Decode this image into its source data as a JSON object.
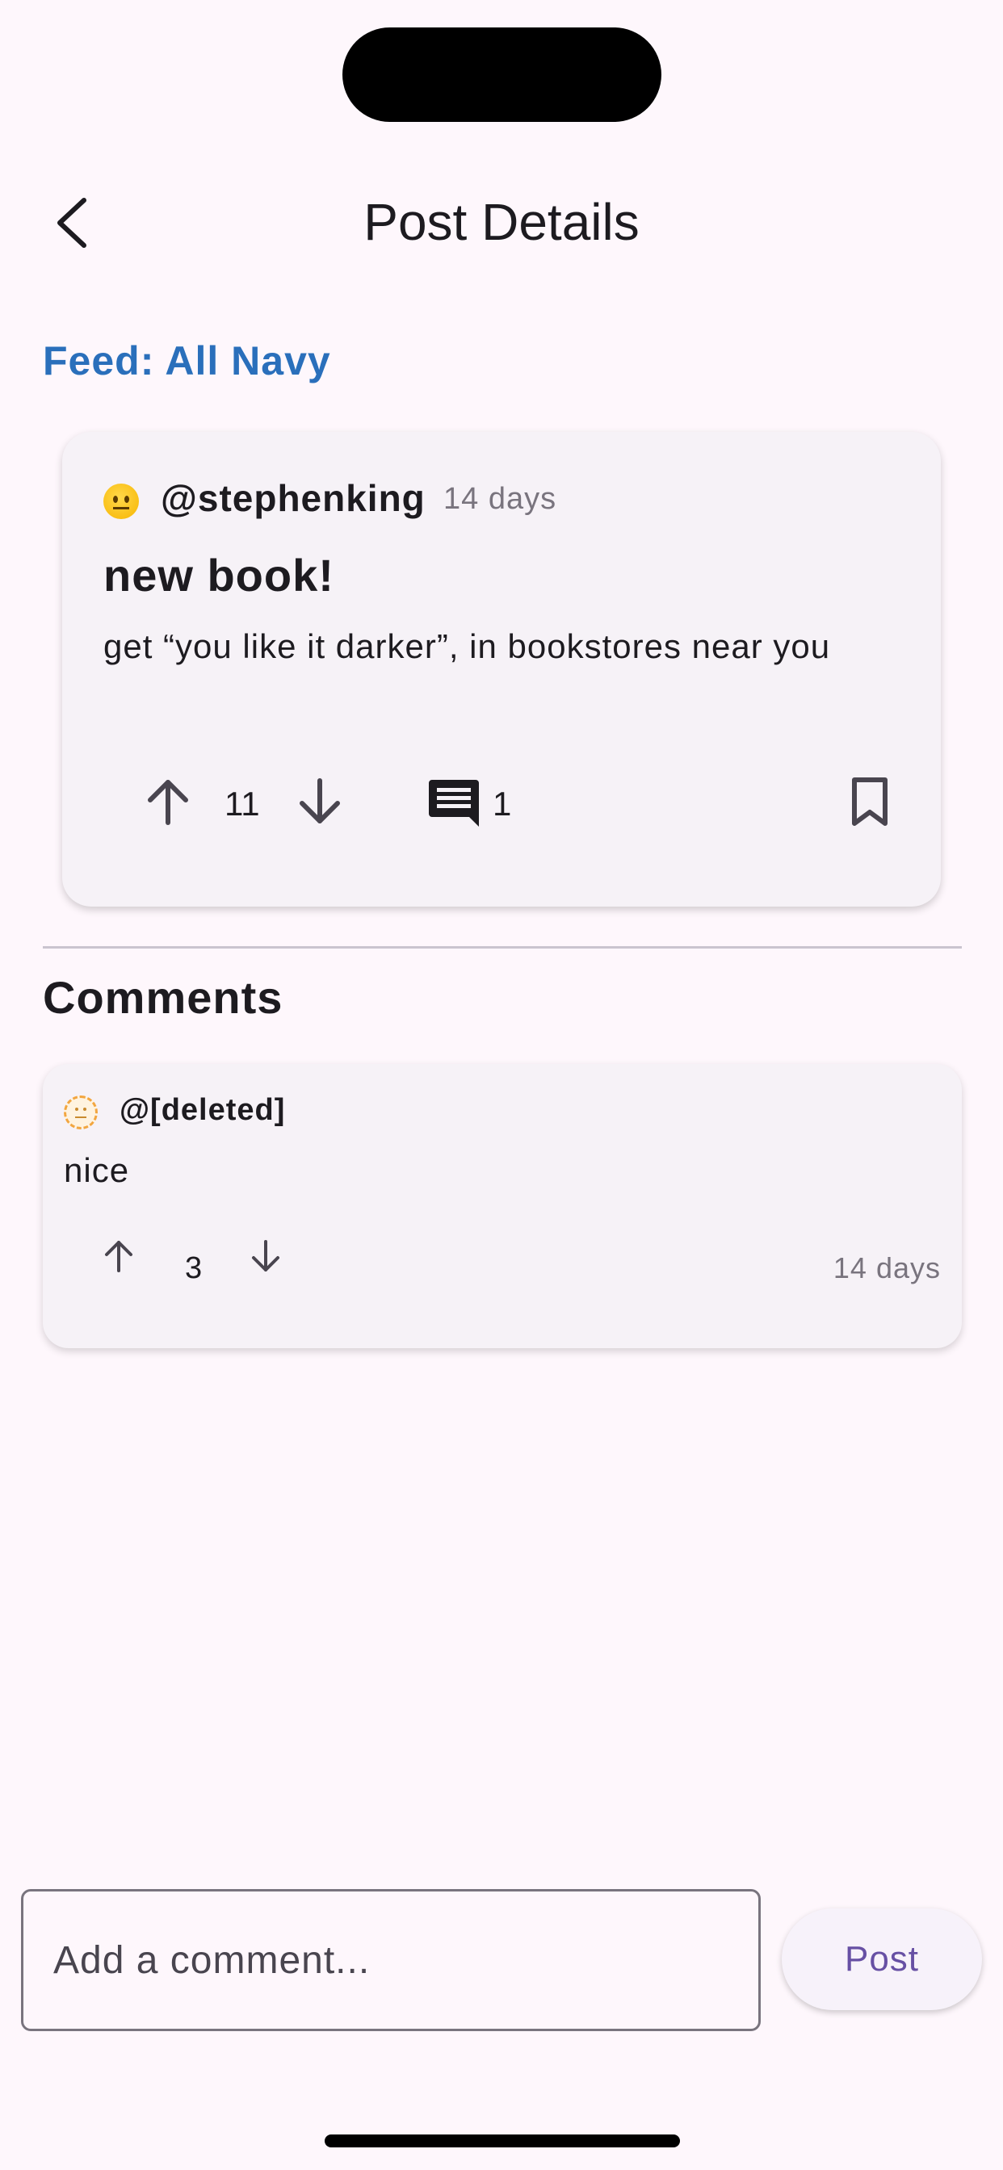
{
  "header": {
    "title": "Post Details",
    "back_icon": "chevron-left-icon"
  },
  "feed": {
    "label": "Feed: All Navy"
  },
  "post": {
    "author": "@stephenking",
    "age": "14 days",
    "title": "new book!",
    "body": "get “you like it darker”, in bookstores near you",
    "votes": "11",
    "comment_count": "1",
    "icons": {
      "upvote": "arrow-up-icon",
      "downvote": "arrow-down-icon",
      "comments": "comment-icon",
      "bookmark": "bookmark-icon"
    }
  },
  "comments_section": {
    "heading": "Comments",
    "items": [
      {
        "author": "@[deleted]",
        "text": "nice",
        "votes": "3",
        "age": "14 days"
      }
    ]
  },
  "composer": {
    "placeholder": "Add a comment...",
    "submit_label": "Post"
  },
  "colors": {
    "accent": "#6750A4",
    "feed_link": "#2A6FBB",
    "background": "#FEF7FC",
    "card": "#F6F2F7"
  }
}
